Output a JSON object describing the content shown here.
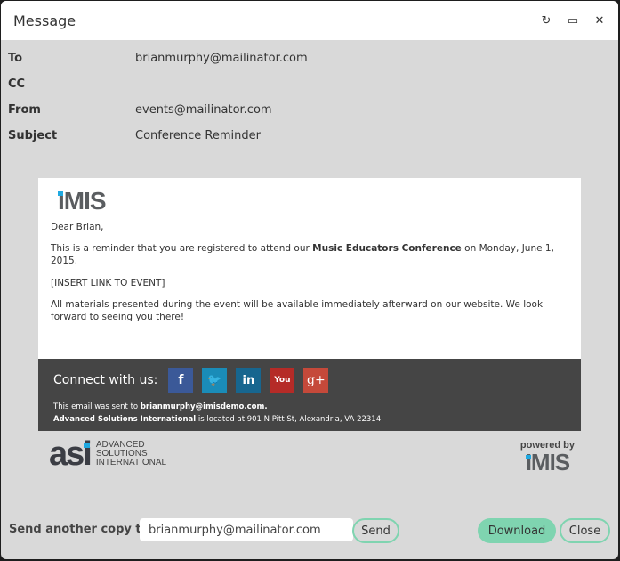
{
  "window": {
    "title": "Message",
    "controls": {
      "refresh": "↻",
      "maximize": "▭",
      "close": "✕"
    }
  },
  "headers": [
    {
      "label": "To",
      "value": "brianmurphy@mailinator.com"
    },
    {
      "label": "CC",
      "value": ""
    },
    {
      "label": "From",
      "value": "events@mailinator.com"
    },
    {
      "label": "Subject",
      "value": "Conference Reminder"
    }
  ],
  "email": {
    "logo": "IMIS",
    "greeting": "Dear Brian,",
    "para1_before": "This is a reminder that you are registered to attend our ",
    "para1_bold": "Music Educators Conference",
    "para1_after": " on Monday, June 1, 2015.",
    "link_placeholder": "[INSERT LINK TO EVENT]",
    "para3": "All materials presented during the event will be available immediately afterward on our website. We look forward to seeing you there!",
    "footer": {
      "connect_label": "Connect with us:",
      "social": [
        {
          "name": "facebook",
          "glyph": "f",
          "color": "#3b5998"
        },
        {
          "name": "twitter",
          "glyph": "🐦",
          "color": "#1a8cb8"
        },
        {
          "name": "linkedin",
          "glyph": "in",
          "color": "#17668f"
        },
        {
          "name": "youtube",
          "glyph": "You",
          "color": "#b52b27"
        },
        {
          "name": "googleplus",
          "glyph": "g+",
          "color": "#c5493a"
        }
      ],
      "sent_to_prefix": "This email was sent to ",
      "sent_to_email": "brianmurphy@imisdemo.com.",
      "org_name": "Advanced Solutions International",
      "org_address": " is located at 901 N Pitt St, Alexandria, VA 22314."
    },
    "asi_logo": {
      "mark": "asi",
      "line1": "ADVANCED",
      "line2": "SOLUTIONS",
      "line3": "INTERNATIONAL"
    },
    "powered_by": "powered by",
    "powered_logo": "IMIS"
  },
  "bottom": {
    "send_label": "Send another copy to",
    "send_input_value": "brianmurphy@mailinator.com",
    "send_button": "Send",
    "download_button": "Download",
    "close_button": "Close"
  },
  "colors": {
    "accent": "#7fd4b0",
    "imis_blue": "#1fa9e1",
    "footer_bg": "#454545"
  }
}
